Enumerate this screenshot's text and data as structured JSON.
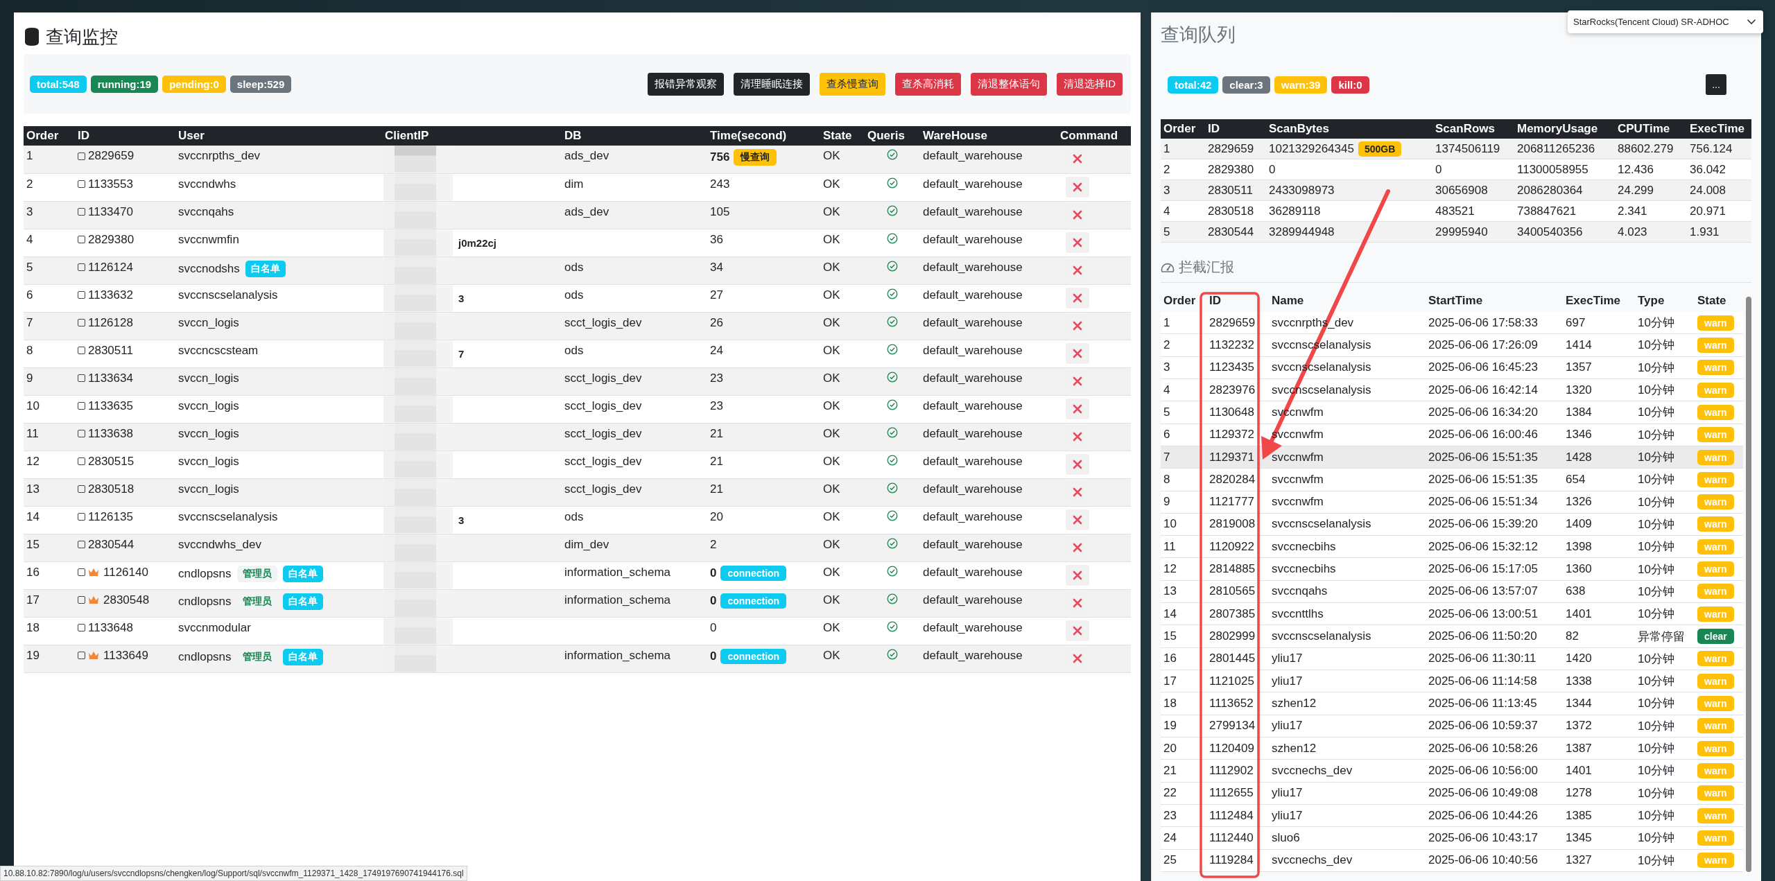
{
  "monitor": {
    "title": "查询监控",
    "badges": [
      {
        "text": "total:548",
        "color": "#0dcaf0"
      },
      {
        "text": "running:19",
        "color": "#198754"
      },
      {
        "text": "pending:0",
        "color": "#ffc107"
      },
      {
        "text": "sleep:529",
        "color": "#6c757d"
      }
    ],
    "buttons": [
      {
        "label": "报错异常观察",
        "kind": "dark"
      },
      {
        "label": "清理睡眠连接",
        "kind": "dark"
      },
      {
        "label": "查杀慢查询",
        "kind": "warning"
      },
      {
        "label": "查杀高消耗",
        "kind": "danger"
      },
      {
        "label": "清退整体语句",
        "kind": "danger"
      },
      {
        "label": "清退选择ID",
        "kind": "danger"
      }
    ],
    "columns": [
      "Order",
      "ID",
      "User",
      "ClientIP",
      "DB",
      "Time(second)",
      "State",
      "Queris",
      "WareHouse",
      "Command"
    ],
    "rows": [
      {
        "order": "1",
        "id": "2829659",
        "checked": false,
        "admin": false,
        "user": "svccnrpths_dev",
        "tags": [],
        "db": "ads_dev",
        "time": "756",
        "time_badge": {
          "text": "慢查询",
          "kind": "slow"
        },
        "state": "OK",
        "warehouse": "default_warehouse"
      },
      {
        "order": "2",
        "id": "1133553",
        "checked": false,
        "admin": false,
        "user": "svccndwhs",
        "tags": [],
        "db": "dim",
        "time": "243",
        "state": "OK",
        "warehouse": "default_warehouse"
      },
      {
        "order": "3",
        "id": "1133470",
        "checked": false,
        "admin": false,
        "user": "svccnqahs",
        "tags": [],
        "db": "ads_dev",
        "time": "105",
        "state": "OK",
        "warehouse": "default_warehouse"
      },
      {
        "order": "4",
        "id": "2829380",
        "checked": false,
        "admin": false,
        "user": "svccnwmfin",
        "tags": [],
        "ip": "j0m22cj",
        "time": "36",
        "state": "OK",
        "warehouse": "default_warehouse"
      },
      {
        "order": "5",
        "id": "1126124",
        "checked": false,
        "admin": false,
        "user": "svccnodshs",
        "tags": [
          {
            "text": "白名单",
            "kind": "whitelist"
          }
        ],
        "db": "ods",
        "time": "34",
        "state": "OK",
        "warehouse": "default_warehouse"
      },
      {
        "order": "6",
        "id": "1133632",
        "checked": false,
        "admin": false,
        "user": "svccnscselanalysis",
        "tags": [],
        "ip": "3",
        "db": "ods",
        "time": "27",
        "state": "OK",
        "warehouse": "default_warehouse"
      },
      {
        "order": "7",
        "id": "1126128",
        "checked": false,
        "admin": false,
        "user": "svccn_logis",
        "tags": [],
        "db": "scct_logis_dev",
        "time": "26",
        "state": "OK",
        "warehouse": "default_warehouse"
      },
      {
        "order": "8",
        "id": "2830511",
        "checked": false,
        "admin": false,
        "user": "svccncscsteam",
        "tags": [],
        "ip": "7",
        "db": "ods",
        "time": "24",
        "state": "OK",
        "warehouse": "default_warehouse"
      },
      {
        "order": "9",
        "id": "1133634",
        "checked": false,
        "admin": false,
        "user": "svccn_logis",
        "tags": [],
        "db": "scct_logis_dev",
        "time": "23",
        "state": "OK",
        "warehouse": "default_warehouse"
      },
      {
        "order": "10",
        "id": "1133635",
        "checked": false,
        "admin": false,
        "user": "svccn_logis",
        "tags": [],
        "db": "scct_logis_dev",
        "time": "23",
        "state": "OK",
        "warehouse": "default_warehouse"
      },
      {
        "order": "11",
        "id": "1133638",
        "checked": false,
        "admin": false,
        "user": "svccn_logis",
        "tags": [],
        "db": "scct_logis_dev",
        "time": "21",
        "state": "OK",
        "warehouse": "default_warehouse"
      },
      {
        "order": "12",
        "id": "2830515",
        "checked": false,
        "admin": false,
        "user": "svccn_logis",
        "tags": [],
        "db": "scct_logis_dev",
        "time": "21",
        "state": "OK",
        "warehouse": "default_warehouse"
      },
      {
        "order": "13",
        "id": "2830518",
        "checked": false,
        "admin": false,
        "user": "svccn_logis",
        "tags": [],
        "db": "scct_logis_dev",
        "time": "21",
        "state": "OK",
        "warehouse": "default_warehouse"
      },
      {
        "order": "14",
        "id": "1126135",
        "checked": false,
        "admin": false,
        "user": "svccnscselanalysis",
        "tags": [],
        "ip": "3",
        "db": "ods",
        "time": "20",
        "state": "OK",
        "warehouse": "default_warehouse"
      },
      {
        "order": "15",
        "id": "2830544",
        "checked": false,
        "admin": false,
        "user": "svccndwhs_dev",
        "tags": [],
        "db": "dim_dev",
        "time": "2",
        "state": "OK",
        "warehouse": "default_warehouse"
      },
      {
        "order": "16",
        "id": "1126140",
        "checked": false,
        "admin": true,
        "user": "cndlopsns",
        "tags": [
          {
            "text": "管理员",
            "kind": "admin"
          },
          {
            "text": "白名单",
            "kind": "whitelist"
          }
        ],
        "db": "information_schema",
        "time": "0",
        "time_badge": {
          "text": "connection",
          "kind": "connection"
        },
        "state": "OK",
        "warehouse": "default_warehouse"
      },
      {
        "order": "17",
        "id": "2830548",
        "checked": false,
        "admin": true,
        "user": "cndlopsns",
        "tags": [
          {
            "text": "管理员",
            "kind": "admin"
          },
          {
            "text": "白名单",
            "kind": "whitelist"
          }
        ],
        "db": "information_schema",
        "time": "0",
        "time_badge": {
          "text": "connection",
          "kind": "connection"
        },
        "state": "OK",
        "warehouse": "default_warehouse"
      },
      {
        "order": "18",
        "id": "1133648",
        "checked": false,
        "admin": false,
        "user": "svccnmodular",
        "tags": [],
        "time": "0",
        "state": "OK",
        "warehouse": "default_warehouse"
      },
      {
        "order": "19",
        "id": "1133649",
        "checked": false,
        "admin": true,
        "user": "cndlopsns",
        "tags": [
          {
            "text": "管理员",
            "kind": "admin"
          },
          {
            "text": "白名单",
            "kind": "whitelist"
          }
        ],
        "db": "information_schema",
        "time": "0",
        "time_badge": {
          "text": "connection",
          "kind": "connection"
        },
        "state": "OK",
        "warehouse": "default_warehouse"
      }
    ]
  },
  "queue": {
    "title": "查询队列",
    "cluster": "StarRocks(Tencent Cloud) SR-ADHOC",
    "badges": [
      {
        "text": "total:42",
        "color": "#0dcaf0"
      },
      {
        "text": "clear:3",
        "color": "#6c757d"
      },
      {
        "text": "warn:39",
        "color": "#ffc107"
      },
      {
        "text": "kill:0",
        "color": "#dc3545"
      }
    ],
    "more_button": "...",
    "columns": [
      "Order",
      "ID",
      "ScanBytes",
      "ScanRows",
      "MemoryUsage",
      "CPUTime",
      "ExecTime"
    ],
    "rows": [
      {
        "order": "1",
        "id": "2829659",
        "scan_bytes": "1021329264345",
        "scan_badge": "500GB",
        "scan_rows": "1374506119",
        "memory": "206811265236",
        "cpu": "88602.279",
        "exec": "756.124"
      },
      {
        "order": "2",
        "id": "2829380",
        "scan_bytes": "0",
        "scan_rows": "0",
        "memory": "11300058955",
        "cpu": "12.436",
        "exec": "36.042"
      },
      {
        "order": "3",
        "id": "2830511",
        "scan_bytes": "2433098973",
        "scan_rows": "30656908",
        "memory": "2086280364",
        "cpu": "24.299",
        "exec": "24.008"
      },
      {
        "order": "4",
        "id": "2830518",
        "scan_bytes": "36289118",
        "scan_rows": "483521",
        "memory": "738847621",
        "cpu": "2.341",
        "exec": "20.971"
      },
      {
        "order": "5",
        "id": "2830544",
        "scan_bytes": "3289944948",
        "scan_rows": "29995940",
        "memory": "3400540356",
        "cpu": "4.023",
        "exec": "1.931"
      }
    ]
  },
  "report": {
    "title": "拦截汇报",
    "columns": [
      "Order",
      "ID",
      "Name",
      "StartTime",
      "ExecTime",
      "Type",
      "State"
    ],
    "rows": [
      {
        "order": "1",
        "id": "2829659",
        "name": "svccnrpths_dev",
        "start": "2025-06-06 17:58:33",
        "exec": "697",
        "type": "10分钟",
        "state": {
          "text": "warn",
          "color": "#ffc107"
        },
        "selected": false
      },
      {
        "order": "2",
        "id": "1132232",
        "name": "svccnscselanalysis",
        "start": "2025-06-06 17:26:09",
        "exec": "1414",
        "type": "10分钟",
        "state": {
          "text": "warn",
          "color": "#ffc107"
        },
        "selected": false
      },
      {
        "order": "3",
        "id": "1123435",
        "name": "svccnscselanalysis",
        "start": "2025-06-06 16:45:23",
        "exec": "1357",
        "type": "10分钟",
        "state": {
          "text": "warn",
          "color": "#ffc107"
        },
        "selected": false
      },
      {
        "order": "4",
        "id": "2823976",
        "name": "svccnscselanalysis",
        "start": "2025-06-06 16:42:14",
        "exec": "1320",
        "type": "10分钟",
        "state": {
          "text": "warn",
          "color": "#ffc107"
        },
        "selected": false
      },
      {
        "order": "5",
        "id": "1130648",
        "name": "svccnwfm",
        "start": "2025-06-06 16:34:20",
        "exec": "1384",
        "type": "10分钟",
        "state": {
          "text": "warn",
          "color": "#ffc107"
        },
        "selected": false
      },
      {
        "order": "6",
        "id": "1129372",
        "name": "svccnwfm",
        "start": "2025-06-06 16:00:46",
        "exec": "1346",
        "type": "10分钟",
        "state": {
          "text": "warn",
          "color": "#ffc107"
        },
        "selected": false
      },
      {
        "order": "7",
        "id": "1129371",
        "name": "svccnwfm",
        "start": "2025-06-06 15:51:35",
        "exec": "1428",
        "type": "10分钟",
        "state": {
          "text": "warn",
          "color": "#ffc107"
        },
        "selected": true
      },
      {
        "order": "8",
        "id": "2820284",
        "name": "svccnwfm",
        "start": "2025-06-06 15:51:35",
        "exec": "654",
        "type": "10分钟",
        "state": {
          "text": "warn",
          "color": "#ffc107"
        },
        "selected": false
      },
      {
        "order": "9",
        "id": "1121777",
        "name": "svccnwfm",
        "start": "2025-06-06 15:51:34",
        "exec": "1326",
        "type": "10分钟",
        "state": {
          "text": "warn",
          "color": "#ffc107"
        },
        "selected": false
      },
      {
        "order": "10",
        "id": "2819008",
        "name": "svccnscselanalysis",
        "start": "2025-06-06 15:39:20",
        "exec": "1409",
        "type": "10分钟",
        "state": {
          "text": "warn",
          "color": "#ffc107"
        },
        "selected": false
      },
      {
        "order": "11",
        "id": "1120922",
        "name": "svccnecbihs",
        "start": "2025-06-06 15:32:12",
        "exec": "1398",
        "type": "10分钟",
        "state": {
          "text": "warn",
          "color": "#ffc107"
        },
        "selected": false
      },
      {
        "order": "12",
        "id": "2814885",
        "name": "svccnecbihs",
        "start": "2025-06-06 15:17:05",
        "exec": "1360",
        "type": "10分钟",
        "state": {
          "text": "warn",
          "color": "#ffc107"
        },
        "selected": false
      },
      {
        "order": "13",
        "id": "2810565",
        "name": "svccnqahs",
        "start": "2025-06-06 13:57:07",
        "exec": "638",
        "type": "10分钟",
        "state": {
          "text": "warn",
          "color": "#ffc107"
        },
        "selected": false
      },
      {
        "order": "14",
        "id": "2807385",
        "name": "svccnttlhs",
        "start": "2025-06-06 13:00:51",
        "exec": "1401",
        "type": "10分钟",
        "state": {
          "text": "warn",
          "color": "#ffc107"
        },
        "selected": false
      },
      {
        "order": "15",
        "id": "2802999",
        "name": "svccnscselanalysis",
        "start": "2025-06-06 11:50:20",
        "exec": "82",
        "type": "异常停留",
        "state": {
          "text": "clear",
          "color": "#198754"
        },
        "selected": false
      },
      {
        "order": "16",
        "id": "2801445",
        "name": "yliu17",
        "start": "2025-06-06 11:30:11",
        "exec": "1420",
        "type": "10分钟",
        "state": {
          "text": "warn",
          "color": "#ffc107"
        },
        "selected": false
      },
      {
        "order": "17",
        "id": "1121025",
        "name": "yliu17",
        "start": "2025-06-06 11:14:58",
        "exec": "1338",
        "type": "10分钟",
        "state": {
          "text": "warn",
          "color": "#ffc107"
        },
        "selected": false
      },
      {
        "order": "18",
        "id": "1113652",
        "name": "szhen12",
        "start": "2025-06-06 11:13:45",
        "exec": "1344",
        "type": "10分钟",
        "state": {
          "text": "warn",
          "color": "#ffc107"
        },
        "selected": false
      },
      {
        "order": "19",
        "id": "2799134",
        "name": "yliu17",
        "start": "2025-06-06 10:59:37",
        "exec": "1372",
        "type": "10分钟",
        "state": {
          "text": "warn",
          "color": "#ffc107"
        },
        "selected": false
      },
      {
        "order": "20",
        "id": "1120409",
        "name": "szhen12",
        "start": "2025-06-06 10:58:26",
        "exec": "1387",
        "type": "10分钟",
        "state": {
          "text": "warn",
          "color": "#ffc107"
        },
        "selected": false
      },
      {
        "order": "21",
        "id": "1112902",
        "name": "svccnechs_dev",
        "start": "2025-06-06 10:56:00",
        "exec": "1401",
        "type": "10分钟",
        "state": {
          "text": "warn",
          "color": "#ffc107"
        },
        "selected": false
      },
      {
        "order": "22",
        "id": "1112655",
        "name": "yliu17",
        "start": "2025-06-06 10:49:08",
        "exec": "1278",
        "type": "10分钟",
        "state": {
          "text": "warn",
          "color": "#ffc107"
        },
        "selected": false
      },
      {
        "order": "23",
        "id": "1112484",
        "name": "yliu17",
        "start": "2025-06-06 10:44:26",
        "exec": "1385",
        "type": "10分钟",
        "state": {
          "text": "warn",
          "color": "#ffc107"
        },
        "selected": false
      },
      {
        "order": "24",
        "id": "1112440",
        "name": "sluo6",
        "start": "2025-06-06 10:43:17",
        "exec": "1345",
        "type": "10分钟",
        "state": {
          "text": "warn",
          "color": "#ffc107"
        },
        "selected": false
      },
      {
        "order": "25",
        "id": "1119284",
        "name": "svccnechs_dev",
        "start": "2025-06-06 10:40:56",
        "exec": "1327",
        "type": "10分钟",
        "state": {
          "text": "warn",
          "color": "#ffc107"
        },
        "selected": false
      }
    ]
  },
  "status_url": "10.88.10.82:7890/log/u/users/svccndlopsns/chengken/log/Support/sql/svccnwfm_1129371_1428_1749197690741944176.sql"
}
